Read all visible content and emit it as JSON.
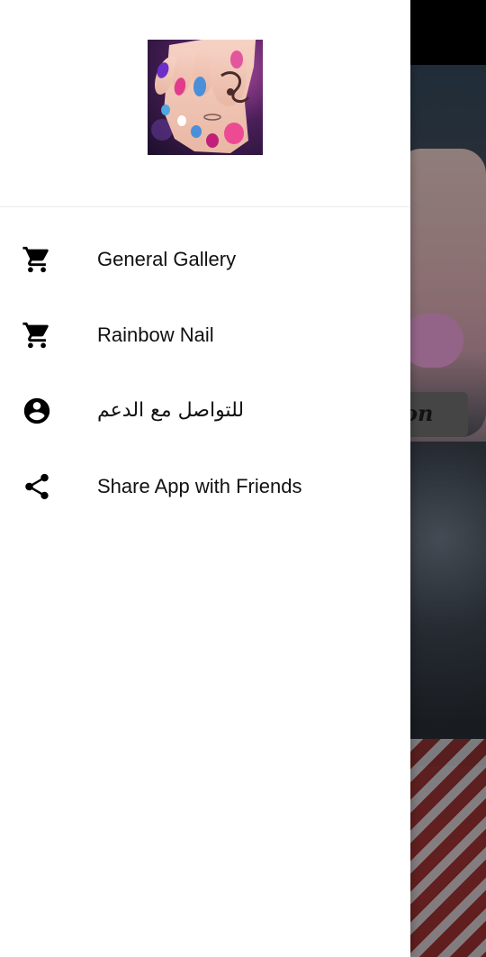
{
  "drawer": {
    "menu": [
      {
        "label": "General Gallery",
        "icon": "shopping-cart-icon"
      },
      {
        "label": "Rainbow Nail",
        "icon": "shopping-cart-icon"
      },
      {
        "label": "للتواصل مع الدعم",
        "icon": "account-circle-icon"
      },
      {
        "label": "Share App with Friends",
        "icon": "share-icon"
      }
    ]
  },
  "background": {
    "partial_text": "on"
  },
  "colors": {
    "drawer_background": "#ffffff",
    "icon_color": "#000000",
    "text_color": "#111111"
  }
}
